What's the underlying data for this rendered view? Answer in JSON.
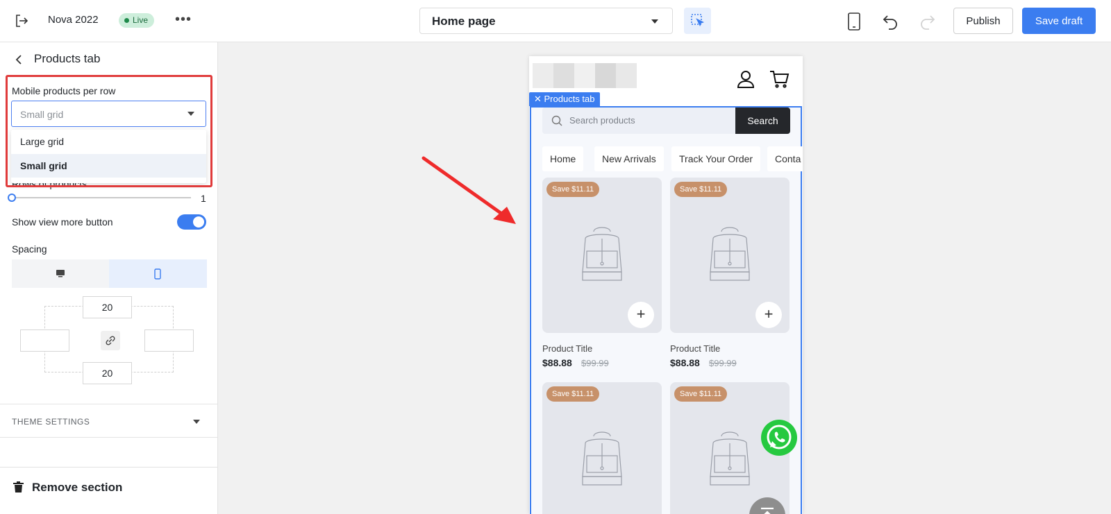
{
  "topbar": {
    "site_name": "Nova 2022",
    "live_label": "Live",
    "more_label": "•••",
    "page_selector": "Home page",
    "publish_label": "Publish",
    "save_draft_label": "Save draft"
  },
  "sidebar": {
    "title": "Products tab",
    "mobile_per_row_label": "Mobile products per row",
    "mobile_per_row_value": "Small grid",
    "mobile_per_row_options": [
      "Large grid",
      "Small grid"
    ],
    "rows_label": "Rows of products",
    "rows_value": "1",
    "show_view_more_label": "Show view more button",
    "show_view_more_on": true,
    "spacing_label": "Spacing",
    "spacing": {
      "top": "20",
      "bottom": "20",
      "left": "",
      "right": ""
    },
    "theme_settings_label": "THEME SETTINGS",
    "remove_section_label": "Remove section"
  },
  "preview": {
    "section_tag": "Products tab",
    "search_placeholder": "Search products",
    "search_button": "Search",
    "nav": [
      "Home",
      "New Arrivals",
      "Track Your Order",
      "Conta"
    ],
    "products": [
      {
        "badge": "Save $11.11",
        "title": "Product Title",
        "price": "$88.88",
        "old_price": "$99.99"
      },
      {
        "badge": "Save $11.11",
        "title": "Product Title",
        "price": "$88.88",
        "old_price": "$99.99"
      },
      {
        "badge": "Save $11.11"
      },
      {
        "badge": "Save $11.11"
      }
    ]
  },
  "colors": {
    "accent": "#3b7df0",
    "highlight": "#e03b3b",
    "badge": "#c7916a",
    "live_badge": "#cdeedb",
    "whatsapp": "#26c940"
  }
}
